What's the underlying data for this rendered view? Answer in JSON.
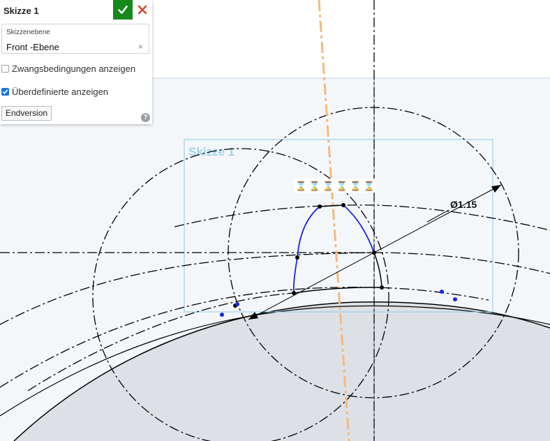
{
  "panel": {
    "title": "Skizze 1",
    "plane_label": "Skizzenebene",
    "plane_value": "Front -Ebene",
    "plane_clear": "×",
    "show_constraints_label": "Zwangsbedingungen anzeigen",
    "show_constraints_checked": false,
    "show_overdefined_label": "Überdefinierte anzeigen",
    "show_overdefined_checked": true,
    "final_button_label": "Endversion",
    "help": "?",
    "accept_icon": "checkmark-icon",
    "close_icon": "close-icon"
  },
  "viewport": {
    "sketch_label": "Skizze 1",
    "dimension_label": "Ø1.15",
    "constraint_glyphs": [
      "⌛",
      "⌛",
      "⌛",
      "⌛",
      "⌛",
      "⌛"
    ],
    "colors": {
      "background": "#f4f7fa",
      "sketch_box": "#8ccbe6",
      "sketch_label": "#9fd3ee",
      "curve_blue": "#1a26e6",
      "construction": "#000000",
      "plane_line": "#f5b97c",
      "gray_region": "#dde1e6",
      "accept_green": "#16891c",
      "close_red": "#d44a2c"
    }
  }
}
